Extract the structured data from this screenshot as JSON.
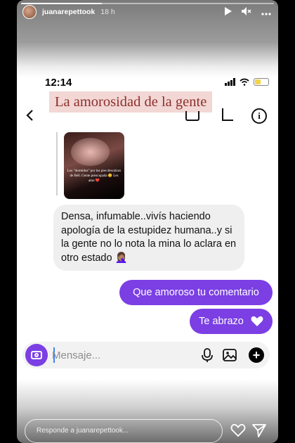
{
  "story": {
    "username": "juanarepettook",
    "time_ago": "18 h",
    "progress": 0.32,
    "reply_placeholder": "Responde a juanarepettook..."
  },
  "screenshot": {
    "status_time": "12:14",
    "caption": "La amorosidad de la gente",
    "shared_media_text": "Los \"dormidos\" por los pies descalzos de Bell. Gente preocupada 😊 Les amo ❤️",
    "messages": {
      "received": "Densa, infumable..vivís haciendo apología de la estupidez humana..y si la gente no lo nota la mina lo aclara en otro estado 🤦🏽‍♀️",
      "sent_1": "Que amoroso tu comentario",
      "sent_2": "Te abrazo"
    },
    "composer_placeholder": "Mensaje..."
  },
  "colors": {
    "accent": "#7b3fe4",
    "caption_bg": "#f2d7d5",
    "caption_text": "#8e2f2c",
    "battery": "#f3d34a"
  },
  "icons": [
    "play-icon",
    "mute-icon",
    "more-icon",
    "back-icon",
    "call-icon",
    "video-icon",
    "info-icon",
    "camera-icon",
    "mic-icon",
    "gallery-icon",
    "plus-icon",
    "heart-icon",
    "send-icon"
  ]
}
